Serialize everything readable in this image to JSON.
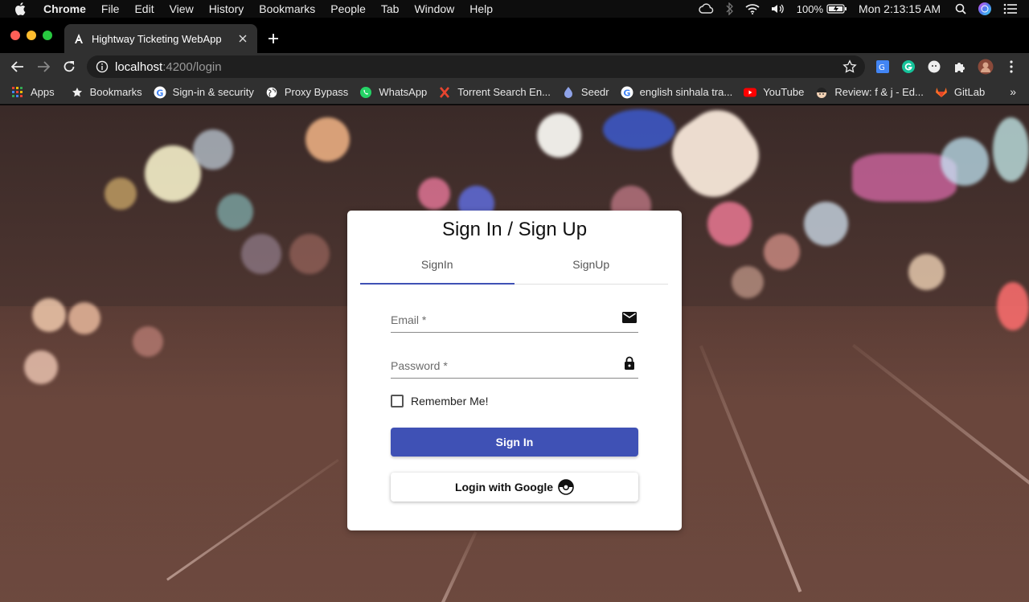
{
  "menubar": {
    "app_name": "Chrome",
    "items": [
      "File",
      "Edit",
      "View",
      "History",
      "Bookmarks",
      "People",
      "Tab",
      "Window",
      "Help"
    ],
    "battery": "100%",
    "clock": "Mon 2:13:15 AM"
  },
  "browser": {
    "tab_title": "Hightway Ticketing WebApp",
    "url_host": "localhost",
    "url_path": ":4200/login"
  },
  "bookmarks": [
    {
      "label": "Apps",
      "icon": "apps-grid-icon"
    },
    {
      "label": "Bookmarks",
      "icon": "star-icon"
    },
    {
      "label": "Sign-in & security",
      "icon": "google-icon"
    },
    {
      "label": "Proxy Bypass",
      "icon": "globe-icon"
    },
    {
      "label": "WhatsApp",
      "icon": "whatsapp-icon"
    },
    {
      "label": "Torrent Search En...",
      "icon": "x-icon"
    },
    {
      "label": "Seedr",
      "icon": "seedr-icon"
    },
    {
      "label": "english sinhala tra...",
      "icon": "google-icon"
    },
    {
      "label": "YouTube",
      "icon": "youtube-icon"
    },
    {
      "label": "Review: f & j - Ed...",
      "icon": "avatar-icon"
    },
    {
      "label": "GitLab",
      "icon": "gitlab-icon"
    }
  ],
  "card": {
    "title": "Sign In / Sign Up",
    "tabs": [
      "SignIn",
      "SignUp"
    ],
    "email_label": "Email *",
    "password_label": "Password *",
    "remember_label": "Remember Me!",
    "signin_button": "Sign In",
    "google_button": "Login with Google"
  },
  "colors": {
    "primary": "#3f51b5",
    "menubar_bg": "#0d0d0d",
    "toolbar_bg": "#303030"
  }
}
